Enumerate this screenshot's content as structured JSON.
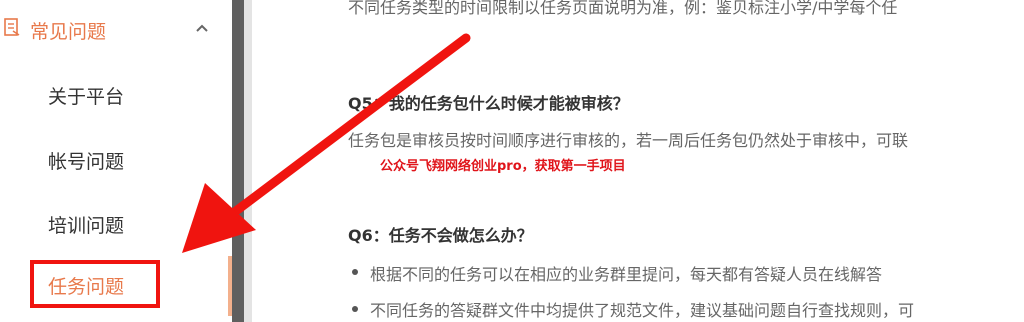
{
  "sidebar": {
    "section_title": "常见问题",
    "items": [
      {
        "label": "关于平台"
      },
      {
        "label": "帐号问题"
      },
      {
        "label": "培训问题"
      },
      {
        "label": "任务问题"
      }
    ]
  },
  "content": {
    "top_line": "不同任务类型的时间限制以任务页面说明为准，例：鉴贝标注小学/中学每个任",
    "q5_title": "Q5：我的任务包什么时候才能被审核？",
    "q5_body": "任务包是审核员按时间顺序进行审核的，若一周后任务包仍然处于审核中，可联",
    "watermark": "公众号飞翔网络创业pro，获取第一手项目",
    "q6_title": "Q6：任务不会做怎么办？",
    "q6_bullets": [
      "根据不同的任务可以在相应的业务群里提问，每天都有答疑人员在线解答",
      "不同任务的答疑群文件中均提供了规范文件，建议基础问题自行查找规则，可"
    ]
  },
  "colors": {
    "accent": "#e8794b",
    "annotation_red": "#f0140f"
  }
}
